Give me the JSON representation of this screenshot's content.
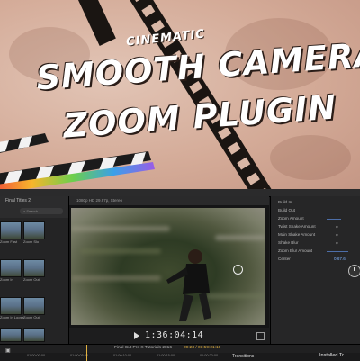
{
  "banner": {
    "tagline": "CINEMATIC",
    "headline_line1": "SMOOTH CAMERA",
    "headline_line2": "ZOOM PLUGIN",
    "colors": {
      "background": "#d4ab98",
      "text": "#ffffff"
    }
  },
  "browser": {
    "title": "Final Titles 2",
    "search_placeholder": "Search",
    "items": [
      {
        "label": "Zoom Fast"
      },
      {
        "label": "Zoom Slo"
      },
      {
        "label": "Zoom In"
      },
      {
        "label": "Zoom Out"
      },
      {
        "label": "Zoom In Loose"
      },
      {
        "label": "Zoom Out"
      }
    ]
  },
  "viewer": {
    "info": "1080p HD 29.97p, Stereo",
    "timecode": "1:36:04:14"
  },
  "inspector": {
    "rows": [
      {
        "label": "Build In"
      },
      {
        "label": "Build Out"
      },
      {
        "label": "Zoom Amount"
      },
      {
        "label": "Twist Shake Amount"
      },
      {
        "label": "Main Shake Amount"
      },
      {
        "label": "Shake Blur"
      },
      {
        "label": "Zoom Blur Amount"
      },
      {
        "label": "Center",
        "value": "0   67.6"
      }
    ]
  },
  "timeline": {
    "project_title": "Final Cut Pro X Tutorials 2016",
    "position": "09:23 / 01:59:21:10",
    "ticks": [
      "01:00:00:00",
      "01:00:05:00",
      "01:00:10:00",
      "01:00:15:00",
      "01:00:20:00"
    ],
    "transitions_label": "Transitions",
    "installed_label": "Installed Tr"
  },
  "icons": [
    "search-icon",
    "play-icon",
    "fullscreen-icon",
    "heart-icon",
    "knob-icon",
    "clapper-logo"
  ]
}
